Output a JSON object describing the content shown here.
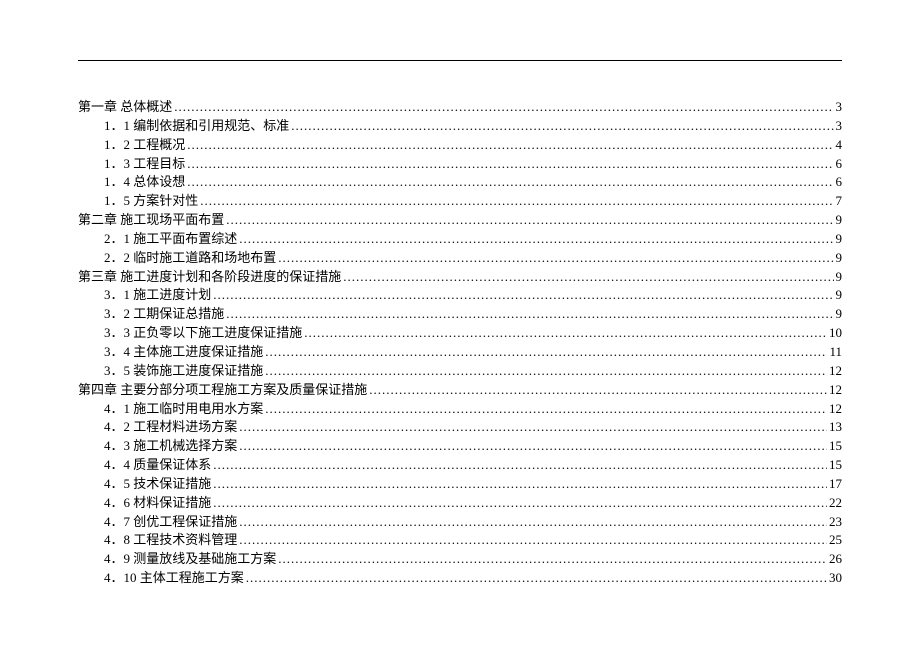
{
  "toc": [
    {
      "level": 1,
      "title": "第一章   总体概述",
      "page": "3"
    },
    {
      "level": 2,
      "title": "1．1 编制依据和引用规范、标准",
      "page": "3"
    },
    {
      "level": 2,
      "title": "1．2 工程概况",
      "page": "4"
    },
    {
      "level": 2,
      "title": "1．3 工程目标",
      "page": "6"
    },
    {
      "level": 2,
      "title": "1．4 总体设想",
      "page": "6"
    },
    {
      "level": 2,
      "title": "1．5 方案针对性",
      "page": "7"
    },
    {
      "level": 1,
      "title": "第二章    施工现场平面布置",
      "page": "9"
    },
    {
      "level": 2,
      "title": "2．1 施工平面布置综述",
      "page": "9"
    },
    {
      "level": 2,
      "title": "2．2 临时施工道路和场地布置",
      "page": "9"
    },
    {
      "level": 1,
      "title": "第三章  施工进度计划和各阶段进度的保证措施",
      "page": "9"
    },
    {
      "level": 2,
      "title": "3．1 施工进度计划",
      "page": "9"
    },
    {
      "level": 2,
      "title": "3．2 工期保证总措施",
      "page": "9"
    },
    {
      "level": 2,
      "title": "3．3 正负零以下施工进度保证措施",
      "page": "10"
    },
    {
      "level": 2,
      "title": "3．4 主体施工进度保证措施",
      "page": "11"
    },
    {
      "level": 2,
      "title": "3．5 装饰施工进度保证措施",
      "page": "12"
    },
    {
      "level": 1,
      "title": "第四章  主要分部分项工程施工方案及质量保证措施",
      "page": "12"
    },
    {
      "level": 2,
      "title": "4．1 施工临时用电用水方案",
      "page": "12"
    },
    {
      "level": 2,
      "title": "4．2 工程材料进场方案",
      "page": "13"
    },
    {
      "level": 2,
      "title": "4．3 施工机械选择方案",
      "page": "15"
    },
    {
      "level": 2,
      "title": "4．4 质量保证体系",
      "page": "15"
    },
    {
      "level": 2,
      "title": "4．5 技术保证措施",
      "page": "17"
    },
    {
      "level": 2,
      "title": "4．6 材料保证措施",
      "page": "22"
    },
    {
      "level": 2,
      "title": "4．7 创优工程保证措施",
      "page": "23"
    },
    {
      "level": 2,
      "title": "4．8 工程技术资料管理",
      "page": "25"
    },
    {
      "level": 2,
      "title": "4．9 测量放线及基础施工方案",
      "page": "26"
    },
    {
      "level": 2,
      "title": "4．10 主体工程施工方案",
      "page": "30"
    }
  ]
}
